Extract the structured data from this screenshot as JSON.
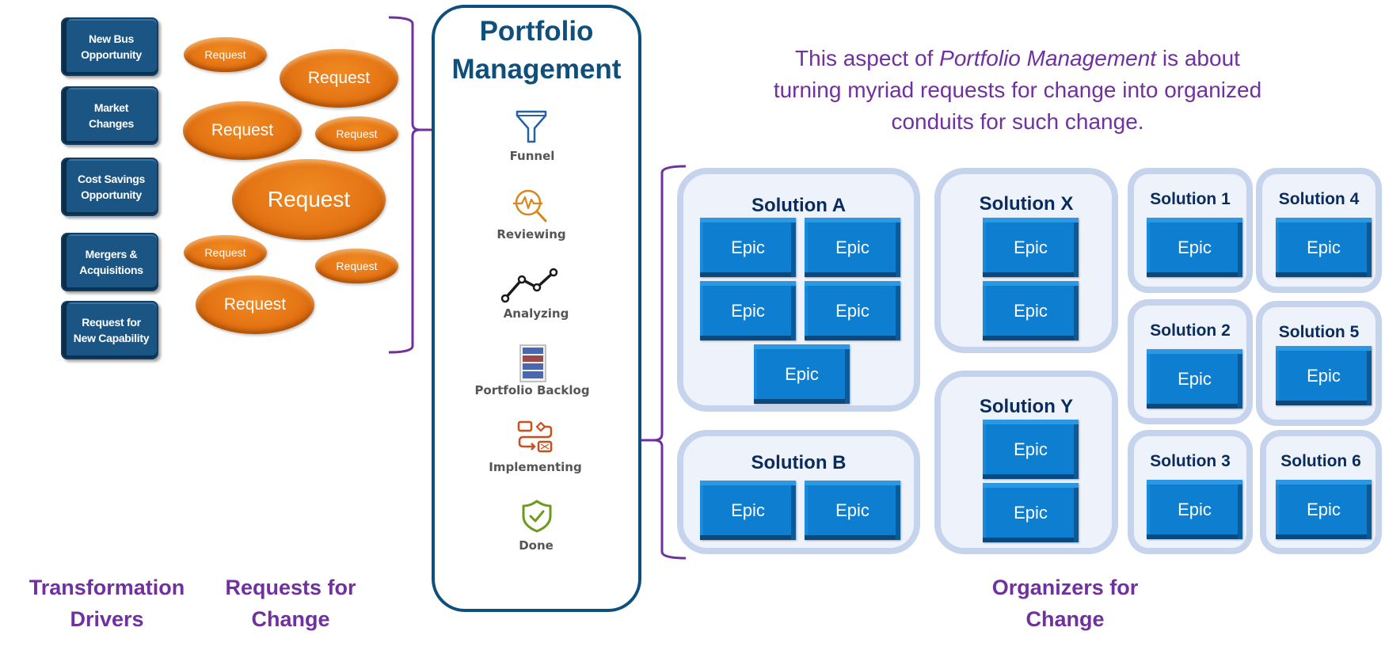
{
  "drivers": [
    {
      "label": "New Bus\nOpportunity"
    },
    {
      "label": "Market\nChanges"
    },
    {
      "label": "Cost Savings\nOpportunity"
    },
    {
      "label": "Mergers &\nAcquisitions"
    },
    {
      "label": "Request for\nNew Capability"
    }
  ],
  "requests": [
    {
      "label": "Request",
      "size": "small"
    },
    {
      "label": "Request",
      "size": "medium"
    },
    {
      "label": "Request",
      "size": "medium"
    },
    {
      "label": "Request",
      "size": "small"
    },
    {
      "label": "Request",
      "size": "large"
    },
    {
      "label": "Request",
      "size": "small"
    },
    {
      "label": "Request",
      "size": "small"
    },
    {
      "label": "Request",
      "size": "medium"
    }
  ],
  "portfolio": {
    "title": "Portfolio\nManagement",
    "stages": [
      {
        "label": "Funnel",
        "icon": "funnel-icon"
      },
      {
        "label": "Reviewing",
        "icon": "magnifier-pulse-icon"
      },
      {
        "label": "Analyzing",
        "icon": "line-chart-icon"
      },
      {
        "label": "Portfolio Backlog",
        "icon": "backlog-stack-icon"
      },
      {
        "label": "Implementing",
        "icon": "workflow-icon"
      },
      {
        "label": "Done",
        "icon": "shield-check-icon"
      }
    ]
  },
  "description": {
    "prefix": "This aspect of ",
    "emphasis": "Portfolio Management",
    "suffix": " is about turning myriad requests for change into organized conduits for such change."
  },
  "solutions": [
    {
      "name": "Solution A",
      "epics": [
        "Epic",
        "Epic",
        "Epic",
        "Epic",
        "Epic"
      ]
    },
    {
      "name": "Solution B",
      "epics": [
        "Epic",
        "Epic"
      ]
    },
    {
      "name": "Solution X",
      "epics": [
        "Epic",
        "Epic"
      ]
    },
    {
      "name": "Solution Y",
      "epics": [
        "Epic",
        "Epic"
      ]
    },
    {
      "name": "Solution 1",
      "epics": [
        "Epic"
      ]
    },
    {
      "name": "Solution 2",
      "epics": [
        "Epic"
      ]
    },
    {
      "name": "Solution 3",
      "epics": [
        "Epic"
      ]
    },
    {
      "name": "Solution 4",
      "epics": [
        "Epic"
      ]
    },
    {
      "name": "Solution 5",
      "epics": [
        "Epic"
      ]
    },
    {
      "name": "Solution 6",
      "epics": [
        "Epic"
      ]
    }
  ],
  "footer": {
    "drivers_label": "Transformation\nDrivers",
    "requests_label": "Requests for\nChange",
    "organizers_label": "Organizers for\nChange"
  },
  "colors": {
    "accent_purple": "#7030a0",
    "portfolio_blue": "#0f4f7c",
    "request_orange": "#e57514",
    "epic_blue": "#0e7fd0",
    "solution_border": "#c5d4ec"
  }
}
